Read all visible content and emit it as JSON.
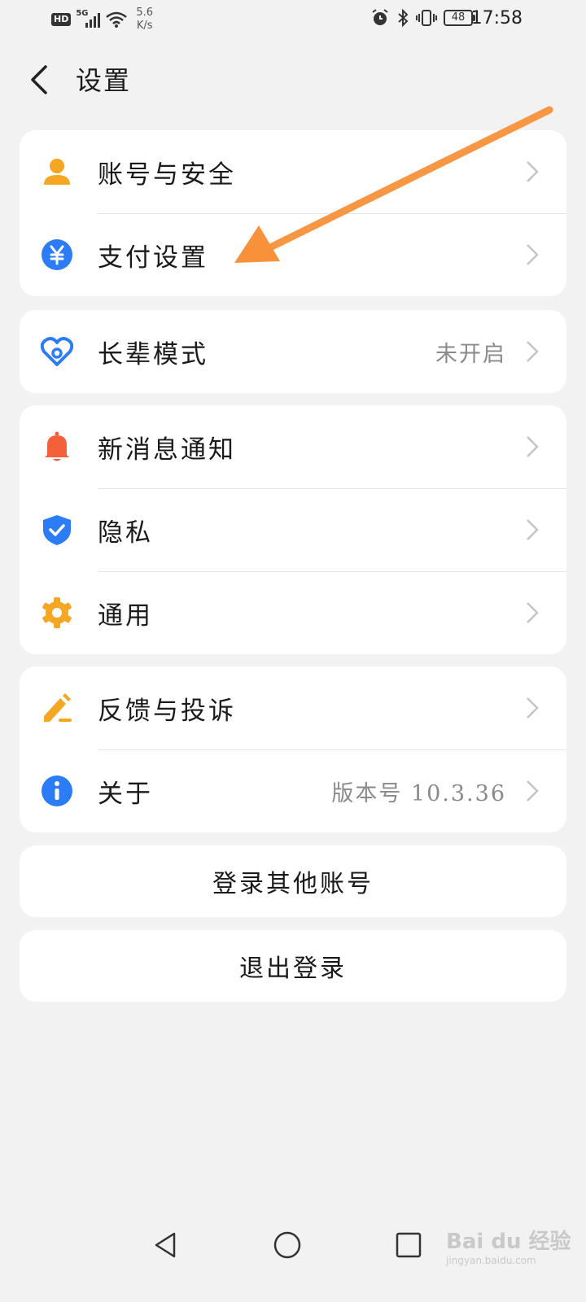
{
  "status_bar": {
    "hd": "HD",
    "network": "5G",
    "speed_value": "5.6",
    "speed_unit": "K/s",
    "battery": "48",
    "time": "17:58"
  },
  "header": {
    "title": "设置"
  },
  "groups": [
    {
      "items": [
        {
          "label": "账号与安全",
          "icon": "person-icon",
          "color": "#f5a623"
        },
        {
          "label": "支付设置",
          "icon": "yuan-icon",
          "color": "#2b7cf6"
        }
      ]
    },
    {
      "items": [
        {
          "label": "长辈模式",
          "value": "未开启",
          "icon": "heart-icon",
          "color": "#2b7cf6"
        }
      ]
    },
    {
      "items": [
        {
          "label": "新消息通知",
          "icon": "bell-icon",
          "color": "#f4603a"
        },
        {
          "label": "隐私",
          "icon": "shield-icon",
          "color": "#2b7cf6"
        },
        {
          "label": "通用",
          "icon": "gear-icon",
          "color": "#f5a623"
        }
      ]
    },
    {
      "items": [
        {
          "label": "反馈与投诉",
          "icon": "pen-icon",
          "color": "#f5a623"
        },
        {
          "label": "关于",
          "value": "版本号 10.3.36",
          "icon": "info-icon",
          "color": "#2b7cf6"
        }
      ]
    }
  ],
  "buttons": {
    "switch_account": "登录其他账号",
    "logout": "退出登录"
  },
  "annotation": {
    "color": "#f7913a"
  },
  "watermark": {
    "brand": "Bai du 经验",
    "url": "jingyan.baidu.com"
  }
}
